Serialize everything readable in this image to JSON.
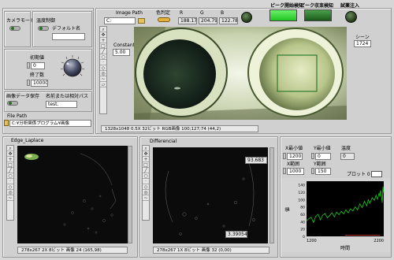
{
  "left": {
    "camera_mode_label": "カメラモード",
    "temp_control_label": "温度制御",
    "default_name_label": "デフォルト名",
    "initial_value_label": "初期値",
    "initial_value": "0",
    "end_value_label": "終了数",
    "end_value": "10000",
    "save_image_label": "画像データ保存",
    "name_or_path_label": "名前または相対パス",
    "name_or_path_value": "test.",
    "file_path_label": "File Path",
    "file_path_value": "C:¥分析関係プログラム¥画像"
  },
  "top": {
    "image_path_label": "Image Path",
    "image_path_value": "C:",
    "color_judge_label": "色判定",
    "r_label": "R",
    "g_label": "G",
    "b_label": "B",
    "r_value": "188.17",
    "g_value": "204.79",
    "b_value": "122.78",
    "peak_start_label": "ピーク開始検知",
    "peak_end_label": "ピーク収束検知",
    "reagent_label": "試薬注入",
    "constant_label": "Constant",
    "constant_value": "5.00",
    "scene_label": "シーン",
    "scene_value": "1724",
    "status_text": "1328x1048 0.5X 32ビット RGB画像 100;127;74   (44,2)"
  },
  "edge": {
    "title": "Edge_Laplace",
    "status_text": "278x267 2X 8ビット 画像 24    (165,98)"
  },
  "diff": {
    "title": "Differencial",
    "value_top": "93.683",
    "value_bottom": "3.39054",
    "status_text": "278x267 1X 8ビット 画像 32    (0,00)"
  },
  "right": {
    "x_min_label": "X最小値",
    "y_min_label": "Y最小値",
    "temp_label": "温度",
    "x_min_value": "1200",
    "y_min_value": "0",
    "temp_value": "0",
    "x_range_label": "X範囲",
    "y_range_label": "Y範囲",
    "x_range_value": "1000",
    "y_range_value": "150",
    "plot_label": "プロット 0"
  },
  "chart_data": {
    "type": "line",
    "xlabel": "時間",
    "ylabel": "値",
    "xlim": [
      1200,
      2200
    ],
    "ylim": [
      0,
      150
    ],
    "x_ticks": [
      "1200",
      "2200"
    ],
    "y_ticks": [
      "0",
      "20",
      "40",
      "60",
      "80",
      "100",
      "120",
      "140"
    ],
    "series": [
      {
        "color": "#19e219",
        "x": [
          1200,
          1230,
          1260,
          1290,
          1320,
          1350,
          1380,
          1410,
          1440,
          1470,
          1500,
          1530,
          1560,
          1590,
          1620,
          1650,
          1680,
          1710,
          1740,
          1770,
          1800,
          1830,
          1860,
          1890,
          1920,
          1950,
          1980,
          2000,
          2020,
          2050,
          2080,
          2100,
          2120,
          2140,
          2150,
          2160,
          2170,
          2180,
          2190,
          2200
        ],
        "y": [
          42,
          48,
          52,
          38,
          55,
          60,
          45,
          58,
          62,
          50,
          57,
          64,
          53,
          66,
          59,
          68,
          61,
          72,
          64,
          75,
          69,
          80,
          72,
          88,
          78,
          95,
          83,
          100,
          90,
          105,
          98,
          112,
          101,
          118,
          108,
          125,
          112,
          92,
          135,
          118
        ]
      },
      {
        "color": "#e23a3a",
        "x": [
          1700,
          1800,
          1900,
          2000,
          2100,
          2150
        ],
        "y": [
          3,
          3,
          3,
          3,
          3,
          3
        ]
      }
    ]
  }
}
